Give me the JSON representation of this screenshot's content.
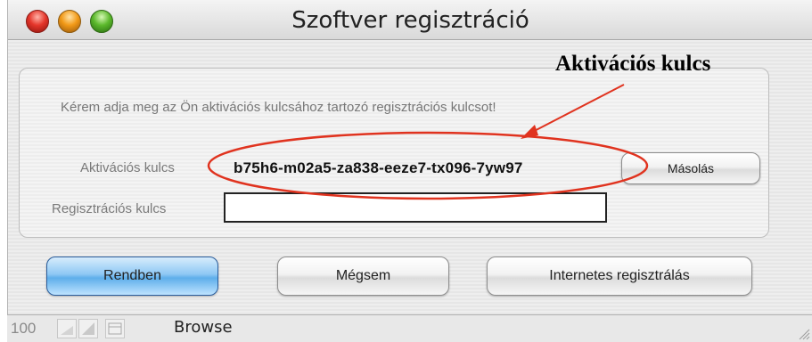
{
  "window": {
    "title": "Szoftver regisztráció"
  },
  "dialog": {
    "instruction": "Kérem adja meg az Ön aktivációs kulcsához tartozó regisztrációs kulcsot!",
    "activation_key_label": "Aktivációs kulcs",
    "activation_key_value": "b75h6-m02a5-za838-eeze7-tx096-7yw97",
    "copy_button_label": "Másolás",
    "registration_key_label": "Regisztrációs kulcs",
    "registration_key_value": "",
    "buttons": {
      "ok": "Rendben",
      "cancel": "Mégsem",
      "web_register": "Internetes regisztrálás"
    }
  },
  "statusbar": {
    "zoom": "100",
    "mode": "Browse"
  },
  "annotation": {
    "text": "Aktivációs kulcs",
    "color": "#e0331f"
  },
  "colors": {
    "ok_button": "#5eaeea",
    "close_light": "#e5362b",
    "minimize_light": "#f29a18",
    "zoom_light": "#5cb92c"
  }
}
